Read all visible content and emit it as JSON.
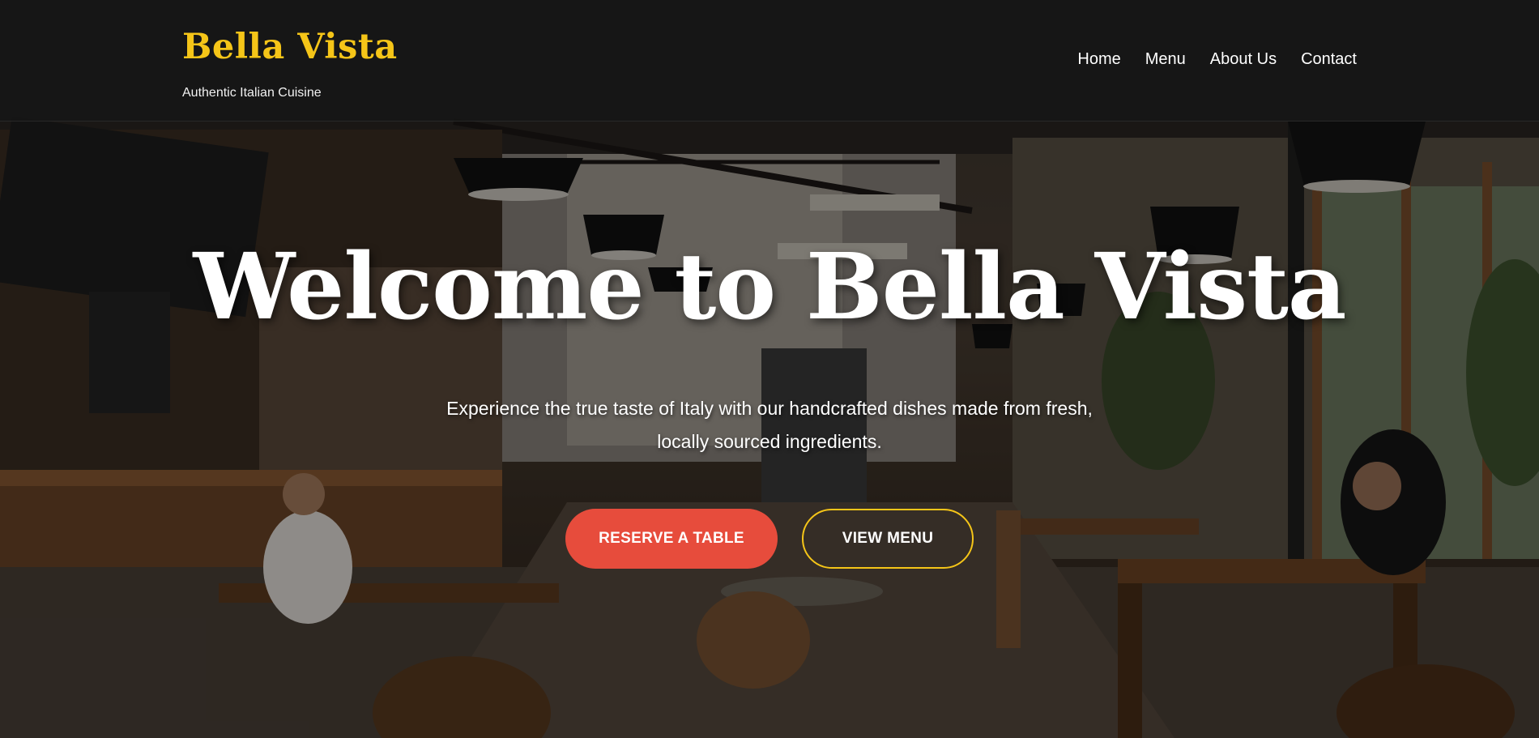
{
  "brand": {
    "name": "Bella Vista",
    "tagline": "Authentic Italian Cuisine"
  },
  "nav": {
    "items": [
      {
        "label": "Home"
      },
      {
        "label": "Menu"
      },
      {
        "label": "About Us"
      },
      {
        "label": "Contact"
      }
    ]
  },
  "hero": {
    "title": "Welcome to Bella Vista",
    "subtitle": "Experience the true taste of Italy with our handcrafted dishes made from fresh, locally sourced ingredients.",
    "primary_button": "RESERVE A TABLE",
    "secondary_button": "VIEW MENU"
  },
  "colors": {
    "brand_accent": "#f5c518",
    "primary_button": "#e74c3c",
    "header_background": "#161616",
    "text": "#ffffff"
  }
}
